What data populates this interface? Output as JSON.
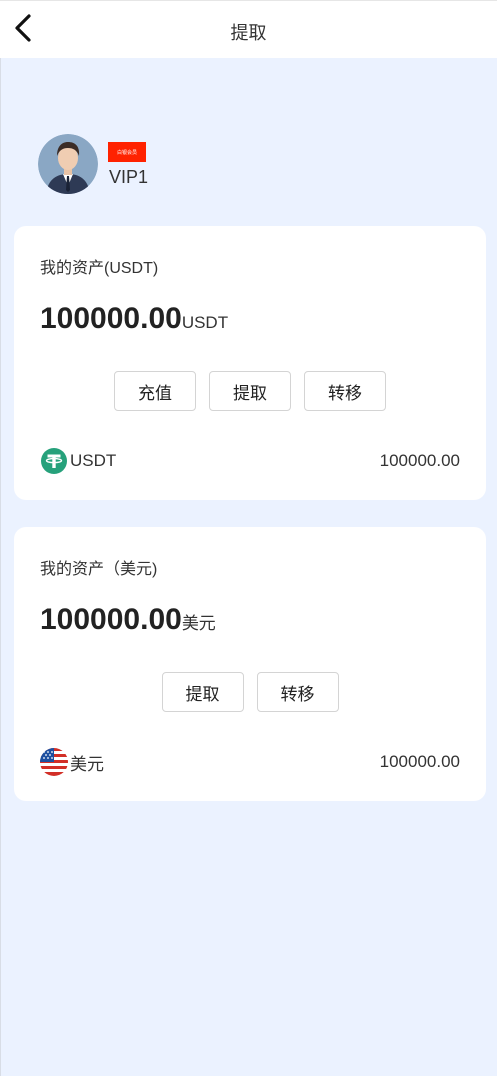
{
  "header": {
    "title": "提取"
  },
  "profile": {
    "badge_text": "白银会员",
    "vip_label": "VIP1"
  },
  "cards": [
    {
      "title": "我的资产(USDT)",
      "amount": "100000.00",
      "unit": "USDT",
      "buttons": [
        "充值",
        "提取",
        "转移"
      ],
      "asset": {
        "icon": "tether-icon",
        "name": "USDT",
        "value": "100000.00"
      }
    },
    {
      "title": "我的资产（美元)",
      "amount": "100000.00",
      "unit": "美元",
      "buttons": [
        "提取",
        "转移"
      ],
      "asset": {
        "icon": "us-flag-icon",
        "name": "美元",
        "value": "100000.00"
      }
    }
  ],
  "colors": {
    "background": "#ebf2ff",
    "badge": "#ff2200",
    "tether": "#26a17b"
  }
}
